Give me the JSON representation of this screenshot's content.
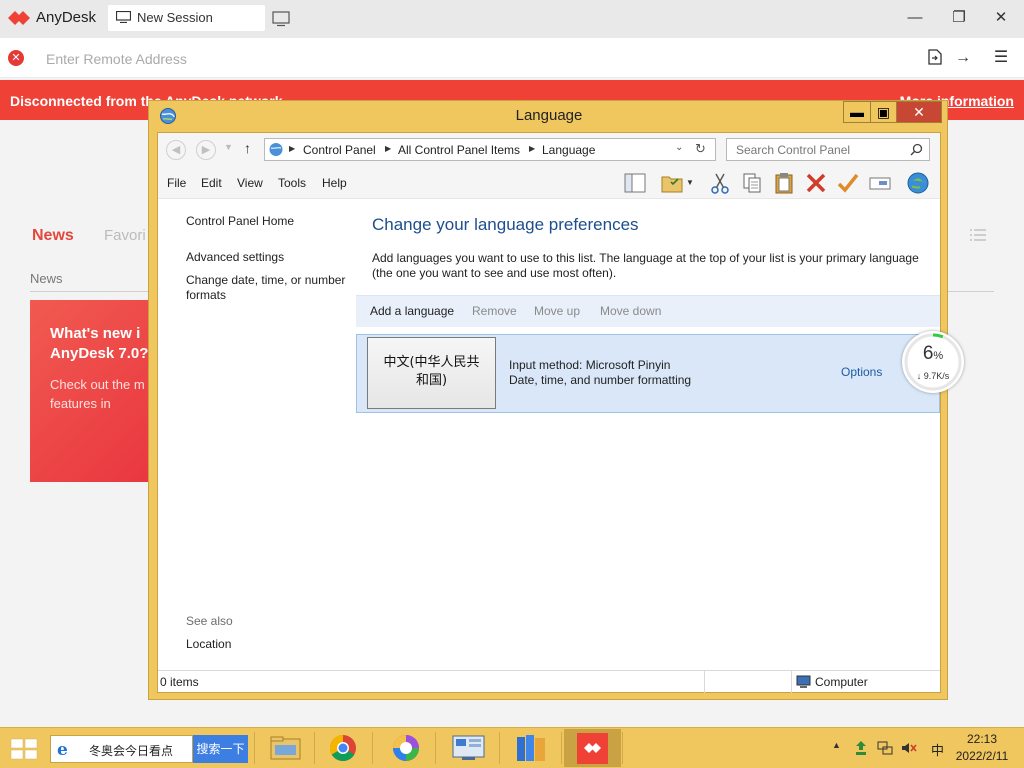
{
  "anydesk": {
    "app_name": "AnyDesk",
    "tab_label": "New Session",
    "address_placeholder": "Enter Remote Address",
    "banner_text": "Disconnected from the AnyDesk network.",
    "banner_link": "More information",
    "tabs": {
      "news": "News",
      "favorites": "Favori"
    },
    "news_label": "News",
    "card": {
      "title": "What's new i AnyDesk 7.0?",
      "body": "Check out the m new features in"
    },
    "brand_color": "#ef4136"
  },
  "control_panel": {
    "window_title": "Language",
    "breadcrumbs": [
      "Control Panel",
      "All Control Panel Items",
      "Language"
    ],
    "search_placeholder": "Search Control Panel",
    "menu": [
      "File",
      "Edit",
      "View",
      "Tools",
      "Help"
    ],
    "sidebar": {
      "home": "Control Panel Home",
      "advanced": "Advanced settings",
      "date_formats": "Change date, time, or number formats",
      "see_also": "See also",
      "location": "Location"
    },
    "heading": "Change your language preferences",
    "description": "Add languages you want to use to this list. The language at the top of your list is your primary language (the one you want to see and use most often).",
    "actions": [
      "Add a language",
      "Remove",
      "Move up",
      "Move down"
    ],
    "language": {
      "name": "中文(中华人民共和国)",
      "name_line1": "中文(中华人民共",
      "name_line2": "和国)",
      "input_method": "Input method: Microsoft Pinyin",
      "formatting": "Date, time, and number formatting",
      "options": "Options"
    },
    "status": {
      "items": "0 items",
      "zone": "Computer"
    }
  },
  "net_meter": {
    "percent": "6",
    "percent_unit": "%",
    "speed": "↓ 9.7K/s"
  },
  "taskbar": {
    "search_text": "冬奥会今日看点",
    "search_button": "搜索一下",
    "ime": "中",
    "time": "22:13",
    "date": "2022/2/11"
  }
}
